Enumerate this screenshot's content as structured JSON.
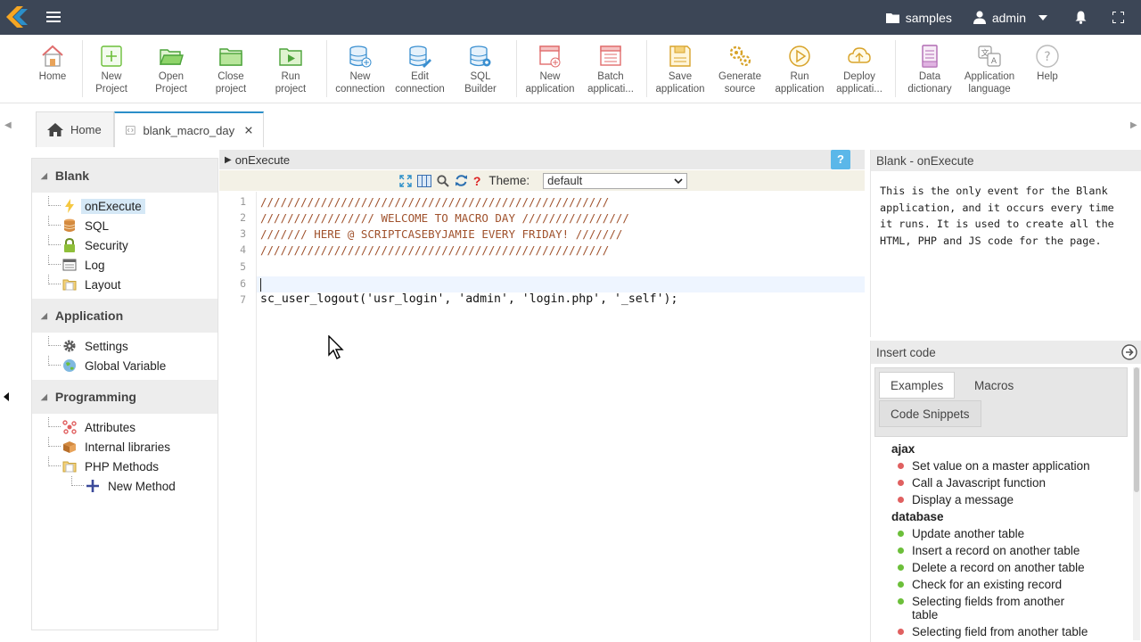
{
  "topbar": {
    "project_label": "samples",
    "user_label": "admin"
  },
  "toolbar": [
    {
      "label": "Home",
      "icon": "home-icon"
    },
    {
      "label": "New\nProject",
      "icon": "new-project-icon"
    },
    {
      "label": "Open\nProject",
      "icon": "open-project-icon"
    },
    {
      "label": "Close\nproject",
      "icon": "close-project-icon"
    },
    {
      "label": "Run\nproject",
      "icon": "run-project-icon"
    },
    {
      "label": "New\nconnection",
      "icon": "new-connection-icon"
    },
    {
      "label": "Edit\nconnection",
      "icon": "edit-connection-icon"
    },
    {
      "label": "SQL\nBuilder",
      "icon": "sql-builder-icon"
    },
    {
      "label": "New\napplication",
      "icon": "new-application-icon"
    },
    {
      "label": "Batch\napplicati...",
      "icon": "batch-application-icon"
    },
    {
      "label": "Save\napplication",
      "icon": "save-application-icon"
    },
    {
      "label": "Generate\nsource",
      "icon": "generate-source-icon"
    },
    {
      "label": "Run\napplication",
      "icon": "run-application-icon"
    },
    {
      "label": "Deploy\napplicati...",
      "icon": "deploy-application-icon"
    },
    {
      "label": "Data\ndictionary",
      "icon": "data-dictionary-icon"
    },
    {
      "label": "Application\nlanguage",
      "icon": "application-language-icon"
    },
    {
      "label": "Help",
      "icon": "help-icon"
    }
  ],
  "tabs": {
    "home": "Home",
    "app": "blank_macro_day"
  },
  "sidebar": {
    "blank": {
      "title": "Blank",
      "items": [
        "onExecute",
        "SQL",
        "Security",
        "Log",
        "Layout"
      ]
    },
    "application": {
      "title": "Application",
      "items": [
        "Settings",
        "Global Variable"
      ]
    },
    "programming": {
      "title": "Programming",
      "items": [
        "Attributes",
        "Internal libraries",
        "PHP Methods",
        "New Method"
      ]
    }
  },
  "editor": {
    "title": "onExecute",
    "help": "?",
    "theme_label": "Theme:",
    "theme_value": "default",
    "lines": [
      "////////////////////////////////////////////////////",
      "///////////////// WELCOME TO MACRO DAY ////////////////",
      "/////// HERE @ SCRIPTCASEBYJAMIE EVERY FRIDAY! ///////",
      "////////////////////////////////////////////////////",
      "",
      "",
      "sc_user_logout('usr_login', 'admin', 'login.php', '_self');"
    ],
    "line_numbers": [
      "1",
      "2",
      "3",
      "4",
      "5",
      "6",
      "7"
    ]
  },
  "info": {
    "title": "Blank - onExecute",
    "text": "This is the only event for the Blank application, and it occurs every time it runs. It is used to create all the HTML, PHP and JS code for the page."
  },
  "insert": {
    "title": "Insert code",
    "tabs": [
      "Examples",
      "Macros",
      "Code Snippets"
    ],
    "categories": [
      {
        "name": "ajax",
        "color": "#e06060",
        "items": [
          "Set value on a master application",
          "Call a Javascript function",
          "Display a message"
        ]
      },
      {
        "name": "database",
        "color": "#6cbf3a",
        "items": [
          "Update another table",
          "Insert a record on another table",
          "Delete a record on another table",
          "Check for an existing record",
          "Selecting fields from another table",
          "Selecting field from another table"
        ]
      }
    ]
  }
}
